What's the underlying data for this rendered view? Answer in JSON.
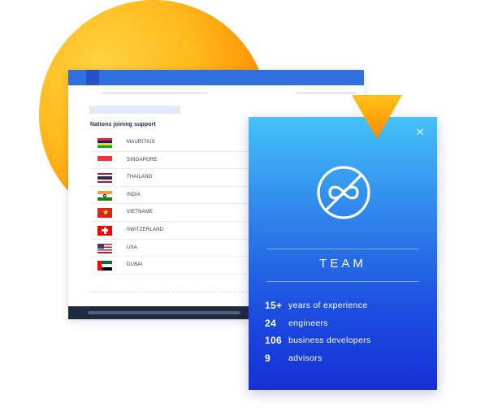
{
  "list": {
    "title": "Nations joining support",
    "countries": [
      {
        "name": "MAURITIUS",
        "flag": "mauritius-flag-icon",
        "colors": [
          "#ea2839",
          "#1a206d",
          "#ffd500",
          "#00a551"
        ]
      },
      {
        "name": "SINGAPORE",
        "flag": "singapore-flag-icon",
        "colors": [
          "#ef3340",
          "#ffffff"
        ]
      },
      {
        "name": "THAILAND",
        "flag": "thailand-flag-icon",
        "colors": [
          "#a51931",
          "#f4f5f8",
          "#2d2a4a",
          "#f4f5f8",
          "#a51931"
        ]
      },
      {
        "name": "INDIA",
        "flag": "india-flag-icon",
        "colors": [
          "#ff9933",
          "#ffffff",
          "#138808"
        ]
      },
      {
        "name": "VIETNAME",
        "flag": "vietnam-flag-icon",
        "colors": [
          "#da251d",
          "#ffff00"
        ]
      },
      {
        "name": "SWITZERLAND",
        "flag": "switzerland-flag-icon",
        "colors": [
          "#ff0000",
          "#ffffff"
        ]
      },
      {
        "name": "USA",
        "flag": "usa-flag-icon",
        "colors": [
          "#b22234",
          "#ffffff",
          "#3c3b6e"
        ]
      },
      {
        "name": "DUBAI",
        "flag": "uae-flag-icon",
        "colors": [
          "#00732f",
          "#ffffff",
          "#000000",
          "#ff0000"
        ]
      }
    ]
  },
  "card": {
    "title": "TEAM",
    "icon": "infinity-strikethrough-icon",
    "close_icon": "close-icon",
    "stats": [
      {
        "number": "15+",
        "label": "years of experience"
      },
      {
        "number": "24",
        "label": "engineers"
      },
      {
        "number": "106",
        "label": "business developers"
      },
      {
        "number": "9",
        "label": "advisors"
      }
    ]
  },
  "colors": {
    "accent": "#2f6fe0",
    "card_top": "#45c2f8",
    "card_bottom": "#1530d6",
    "sun": "#ffb81a",
    "triangle": "#ffa400"
  }
}
